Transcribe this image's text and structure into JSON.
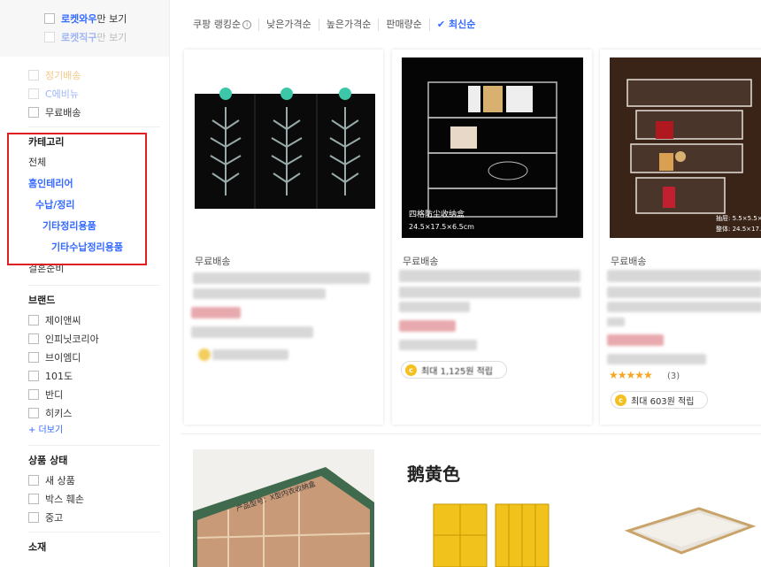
{
  "delivery": {
    "rocket_wow_label": "로켓와우",
    "rocket_wow_suffix": "만 보기",
    "rocket_direct_label": "로켓직구",
    "rocket_direct_suffix": "만 보기"
  },
  "delivery_options": [
    {
      "label": "정기배송",
      "faded": true
    },
    {
      "label": "C에비뉴",
      "faded": true
    },
    {
      "label": "무료배송",
      "faded": false
    }
  ],
  "category": {
    "title": "카테고리",
    "items": [
      {
        "label": "전체",
        "level": 1,
        "active": false
      },
      {
        "label": "홈인테리어",
        "level": 2,
        "active": true
      },
      {
        "label": "수납/정리",
        "level": 3,
        "active": true
      },
      {
        "label": "기타정리용품",
        "level": 4,
        "active": true
      },
      {
        "label": "기타수납정리용품",
        "level": 5,
        "active": true
      }
    ],
    "after_label": "결혼준비"
  },
  "brand": {
    "title": "브랜드",
    "items": [
      "제이앤씨",
      "인피닛코리아",
      "브이엠디",
      "101도",
      "반디",
      "히키스"
    ],
    "more_label": "+ 더보기"
  },
  "condition": {
    "title": "상품 상태",
    "items": [
      "새 상품",
      "박스 훼손",
      "중고"
    ]
  },
  "material": {
    "title": "소재"
  },
  "sort": {
    "items": [
      {
        "label": "쿠팡 랭킹순",
        "active": false,
        "info": true
      },
      {
        "label": "낮은가격순",
        "active": false,
        "info": false
      },
      {
        "label": "높은가격순",
        "active": false,
        "info": false
      },
      {
        "label": "판매량순",
        "active": false,
        "info": false
      },
      {
        "label": "최신순",
        "active": true,
        "info": false
      }
    ]
  },
  "products": [
    {
      "free_shipping": "무료배송",
      "reward": ""
    },
    {
      "free_shipping": "무료배송",
      "reward": "최대 1,125원 적립",
      "image_caption_1": "四格防尘收纳盒",
      "image_caption_2": "24.5×17.5×6.5cm"
    },
    {
      "free_shipping": "무료배송",
      "reward": "최대 603원 적립",
      "review_count": "(3)",
      "image_caption_1": "抽屉: 5.5×5.5×",
      "image_caption_2": "整体: 24.5×17.5×"
    }
  ],
  "row2": {
    "yellow_caption": "鹅黄色",
    "tray_caption": "产品型号：X型内衣收纳盒"
  },
  "colors": {
    "accent": "#346aff",
    "highlight_border": "#e02020",
    "star": "#f5a623",
    "coin": "#f4c020"
  }
}
